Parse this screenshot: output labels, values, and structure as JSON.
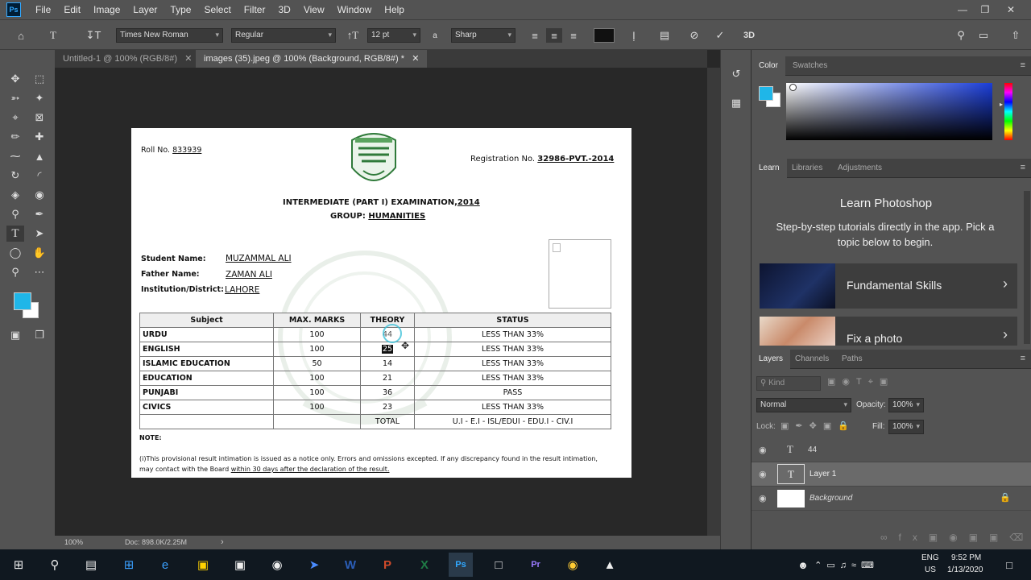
{
  "app": {
    "logo": "Ps",
    "menu": [
      "File",
      "Edit",
      "Image",
      "Layer",
      "Type",
      "Select",
      "Filter",
      "3D",
      "View",
      "Window",
      "Help"
    ]
  },
  "options": {
    "font_family": "Times New Roman",
    "font_style": "Regular",
    "font_size": "12 pt",
    "aa_label": "a",
    "antialias": "Sharp"
  },
  "tabs": [
    {
      "label": "Untitled-1 @ 100% (RGB/8#)"
    },
    {
      "label": "images (35).jpeg @ 100% (Background, RGB/8#) *"
    }
  ],
  "status": {
    "zoom": "100%",
    "doc": "Doc: 898.0K/2.25M"
  },
  "document": {
    "roll_label": "Roll No.",
    "roll_no": "833939",
    "reg_label": "Registration No.",
    "reg_no": "32986-PVT.-2014",
    "exam_title": "INTERMEDIATE (PART I) EXAMINATION,",
    "exam_year": "2014",
    "group_label": "GROUP:",
    "group": "HUMANITIES",
    "student_label": "Student Name:",
    "student": "MUZAMMAL ALI",
    "father_label": "Father Name:",
    "father": "ZAMAN ALI",
    "inst_label": "Institution/District:",
    "inst": "LAHORE",
    "headers": [
      "Subject",
      "MAX. MARKS",
      "THEORY",
      "STATUS"
    ],
    "rows": [
      {
        "subject": "URDU",
        "max": "100",
        "theory": "44",
        "status": "LESS THAN 33%"
      },
      {
        "subject": "ENGLISH",
        "max": "100",
        "theory": "25",
        "status": "LESS THAN 33%"
      },
      {
        "subject": "ISLAMIC EDUCATION",
        "max": "50",
        "theory": "14",
        "status": "LESS THAN 33%"
      },
      {
        "subject": "EDUCATION",
        "max": "100",
        "theory": "21",
        "status": "LESS THAN 33%"
      },
      {
        "subject": "PUNJABI",
        "max": "100",
        "theory": "36",
        "status": "PASS"
      },
      {
        "subject": "CIVICS",
        "max": "100",
        "theory": "23",
        "status": "LESS THAN 33%"
      }
    ],
    "total_label": "TOTAL",
    "total_status": "U.I - E.I - ISL/EDUI - EDU.I - CIV.I",
    "note_label": "NOTE:",
    "note_text": "(i)This provisional result intimation is issued as a notice only. Errors and omissions excepted. If any discrepancy found in the result intimation,",
    "note_text2a": "may contact with the Board ",
    "note_text2b": "within 30 days after the declaration of the result."
  },
  "color_panel": {
    "tabs": [
      "Color",
      "Swatches"
    ],
    "fg": "#1fb6e8",
    "bg": "#ffffff",
    "field_hue": "#1a3dd8"
  },
  "learn_panel": {
    "tabs": [
      "Learn",
      "Libraries",
      "Adjustments"
    ],
    "title": "Learn Photoshop",
    "subtitle": "Step-by-step tutorials directly in the app. Pick a topic below to begin.",
    "cards": [
      {
        "label": "Fundamental Skills"
      },
      {
        "label": "Fix a photo"
      }
    ]
  },
  "layers_panel": {
    "tabs": [
      "Layers",
      "Channels",
      "Paths"
    ],
    "kind": "Kind",
    "blend": "Normal",
    "opacity_label": "Opacity:",
    "opacity": "100%",
    "lock_label": "Lock:",
    "fill_label": "Fill:",
    "fill": "100%",
    "layers": [
      {
        "name": "44",
        "type": "text"
      },
      {
        "name": "Layer 1",
        "type": "text"
      },
      {
        "name": "Background",
        "type": "image"
      }
    ]
  },
  "taskbar": {
    "lang": "ENG",
    "region": "US",
    "time": "9:52 PM",
    "date": "1/13/2020"
  }
}
